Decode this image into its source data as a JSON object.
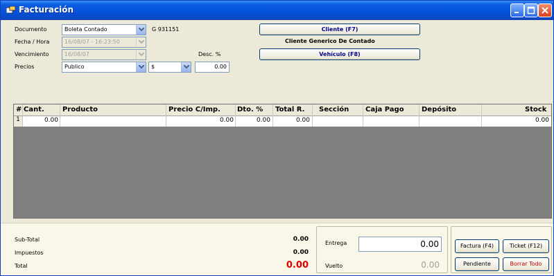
{
  "window": {
    "title": "Facturación"
  },
  "form": {
    "documento_label": "Documento",
    "documento_value": "Boleta Contado",
    "doc_number": "G 931151",
    "fecha_label": "Fecha / Hora",
    "fecha_value": "16/08/07 - 16:23:50",
    "vencimiento_label": "Vencimiento",
    "vencimiento_value": "16/08/07",
    "desc_label": "Desc. %",
    "precios_label": "Precios",
    "precios_value": "Publico",
    "currency_value": "$",
    "desc_value": "0.00",
    "cliente_button": "Cliente (F7)",
    "cliente_name": "Cliente Generico De Contado",
    "vehiculo_button": "Vehículo (F8)"
  },
  "grid": {
    "columns": [
      "#",
      "Cant.",
      "Producto",
      "Precio C/Imp.",
      "Dto. %",
      "Total R.",
      "Sección",
      "Caja Pago",
      "Depósito",
      "Stock"
    ],
    "rows": [
      {
        "num": "1",
        "cant": "0.00",
        "producto": "",
        "precio": "0.00",
        "dto": "0.00",
        "total": "0.00",
        "seccion": "",
        "caja": "",
        "deposito": "",
        "stock": "0.00"
      }
    ]
  },
  "totals": {
    "subtotal_label": "Sub-Total",
    "subtotal_value": "0.00",
    "impuestos_label": "Impuestos",
    "impuestos_value": "0.00",
    "total_label": "Total",
    "total_value": "0.00",
    "total_color": "#e00000"
  },
  "payment": {
    "entrega_label": "Entrega",
    "entrega_value": "0.00",
    "vuelto_label": "Vuelto",
    "vuelto_value": "0.00"
  },
  "actions": {
    "factura": "Factura (F4)",
    "ticket": "Ticket (F12)",
    "pendiente": "Pendiente",
    "borrar": "Borrar Todo",
    "borrar_color": "#c00000"
  },
  "icons": [
    "app-icon",
    "minimize-icon",
    "maximize-icon",
    "close-icon",
    "chevron-down-icon"
  ]
}
